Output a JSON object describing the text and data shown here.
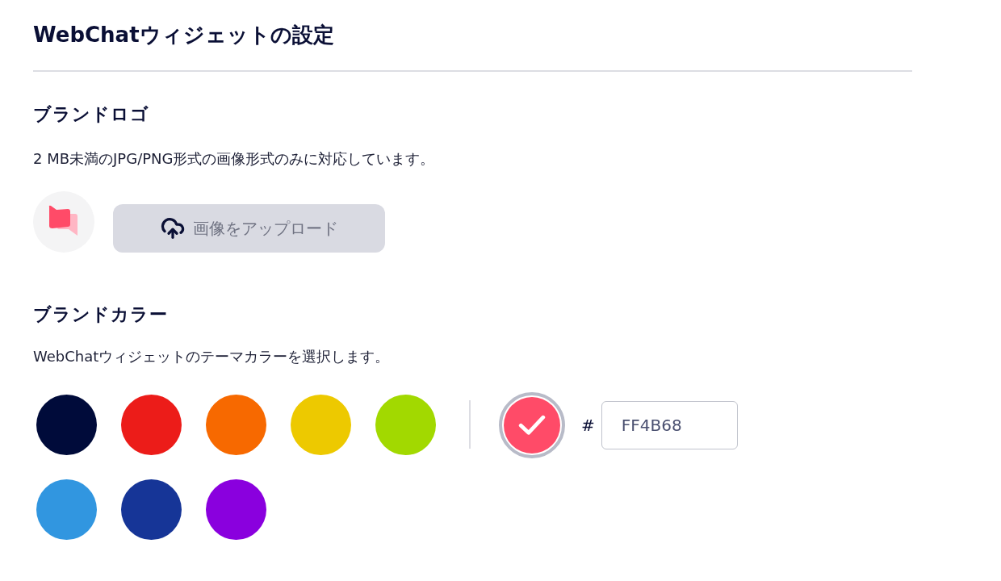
{
  "page": {
    "title": "WebChatウィジェットの設定"
  },
  "brand_logo": {
    "heading": "ブランドロゴ",
    "description": "2 MB未満のJPG/PNG形式の画像形式のみに対応しています。",
    "upload_button": {
      "label": "画像をアップロード"
    }
  },
  "brand_color": {
    "heading": "ブランドカラー",
    "description": "WebChatウィジェットのテーマカラーを選択します。",
    "swatches": [
      {
        "color": "#000b3a",
        "selected": false
      },
      {
        "color": "#ec1c19",
        "selected": false
      },
      {
        "color": "#f76900",
        "selected": false
      },
      {
        "color": "#edc900",
        "selected": false
      },
      {
        "color": "#a2d900",
        "selected": false
      },
      {
        "color": "#3196e0",
        "selected": false
      },
      {
        "color": "#163597",
        "selected": false
      },
      {
        "color": "#8a00de",
        "selected": false
      }
    ],
    "custom": {
      "color": "#ff4b68",
      "selected": true
    },
    "hex_field": {
      "prefix": "#",
      "value": "FF4B68"
    }
  }
}
